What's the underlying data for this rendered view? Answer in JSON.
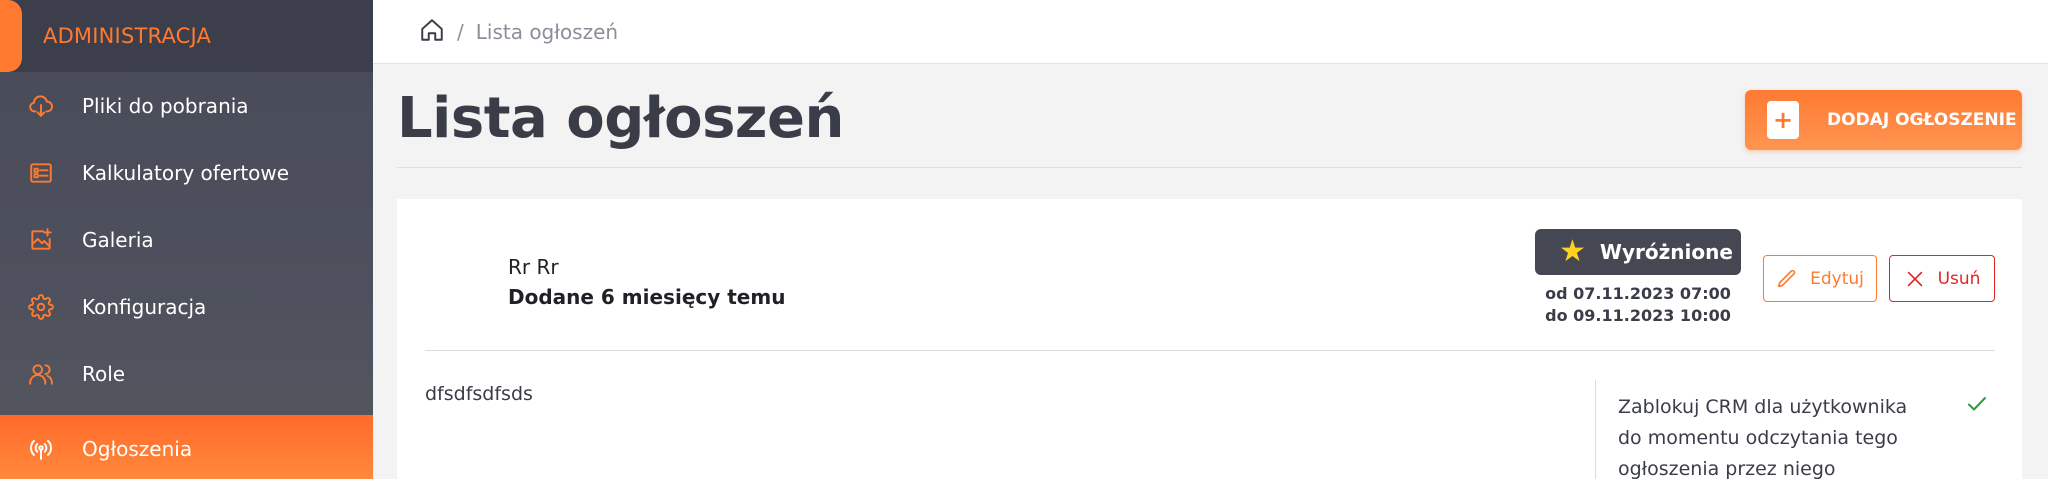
{
  "sidebar": {
    "title": "ADMINISTRACJA",
    "items": [
      {
        "label": "Pliki do pobrania",
        "icon": "cloud-download-icon"
      },
      {
        "label": "Kalkulatory ofertowe",
        "icon": "calculator-list-icon"
      },
      {
        "label": "Galeria",
        "icon": "image-add-icon"
      },
      {
        "label": "Konfiguracja",
        "icon": "gear-icon"
      },
      {
        "label": "Role",
        "icon": "users-icon"
      },
      {
        "label": "Ogłoszenia",
        "icon": "broadcast-icon",
        "active": true
      }
    ]
  },
  "breadcrumb": {
    "separator": "/",
    "current": "Lista ogłoszeń"
  },
  "page": {
    "title": "Lista ogłoszeń",
    "add_button": "DODAJ OGŁOSZENIE"
  },
  "announcement": {
    "author": "Rr Rr",
    "added": "Dodane 6 miesięcy temu",
    "badge": "Wyróżnione",
    "date_from": "od 07.11.2023 07:00",
    "date_to": "do 09.11.2023 10:00",
    "edit_label": "Edytuj",
    "delete_label": "Usuń",
    "content": "dfsdfsdfsds",
    "crm_block": "Zablokuj CRM dla użytkownika do momentu odczytania tego ogłoszenia przez niego"
  },
  "colors": {
    "accent": "#ff7a2f",
    "sidebar": "#4a4d59",
    "danger": "#e32424",
    "success": "#2e9a3c",
    "star": "#ffd21f"
  }
}
